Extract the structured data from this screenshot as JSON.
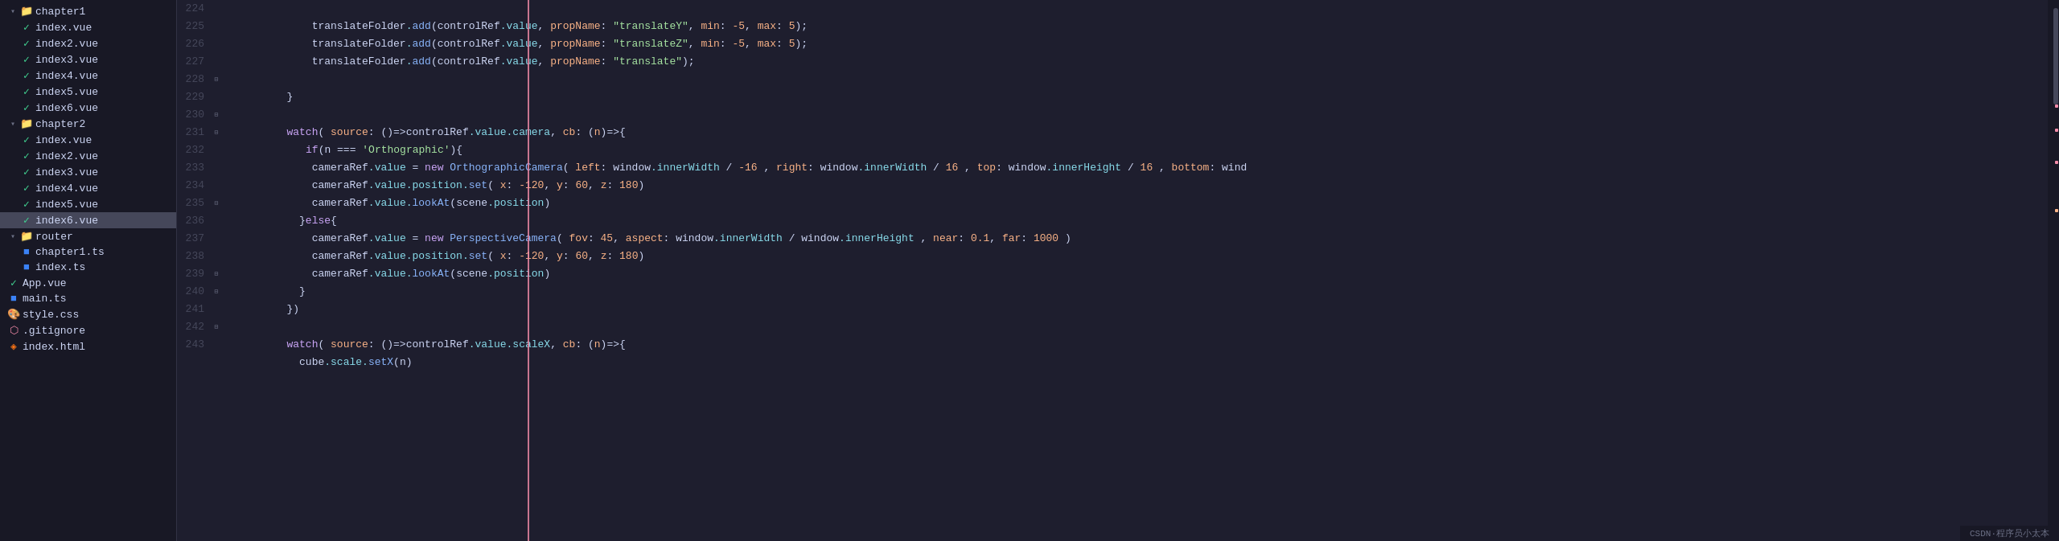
{
  "sidebar": {
    "items": [
      {
        "id": "chapter1-folder",
        "label": "chapter1",
        "type": "folder",
        "indent": 1,
        "expanded": true,
        "icon": "folder"
      },
      {
        "id": "chapter1-index",
        "label": "index.vue",
        "type": "file",
        "indent": 2,
        "icon": "vue"
      },
      {
        "id": "chapter1-index2",
        "label": "index2.vue",
        "type": "file",
        "indent": 2,
        "icon": "vue"
      },
      {
        "id": "chapter1-index3",
        "label": "index3.vue",
        "type": "file",
        "indent": 2,
        "icon": "vue"
      },
      {
        "id": "chapter1-index4",
        "label": "index4.vue",
        "type": "file",
        "indent": 2,
        "icon": "vue"
      },
      {
        "id": "chapter1-index5",
        "label": "index5.vue",
        "type": "file",
        "indent": 2,
        "icon": "vue"
      },
      {
        "id": "chapter1-index6",
        "label": "index6.vue",
        "type": "file",
        "indent": 2,
        "icon": "vue"
      },
      {
        "id": "chapter2-folder",
        "label": "chapter2",
        "type": "folder",
        "indent": 1,
        "expanded": true,
        "icon": "folder"
      },
      {
        "id": "chapter2-index",
        "label": "index.vue",
        "type": "file",
        "indent": 2,
        "icon": "vue"
      },
      {
        "id": "chapter2-index2",
        "label": "index2.vue",
        "type": "file",
        "indent": 2,
        "icon": "vue"
      },
      {
        "id": "chapter2-index3",
        "label": "index3.vue",
        "type": "file",
        "indent": 2,
        "icon": "vue"
      },
      {
        "id": "chapter2-index4",
        "label": "index4.vue",
        "type": "file",
        "indent": 2,
        "icon": "vue"
      },
      {
        "id": "chapter2-index5",
        "label": "index5.vue",
        "type": "file",
        "indent": 2,
        "icon": "vue"
      },
      {
        "id": "chapter2-index6",
        "label": "index6.vue",
        "type": "file",
        "indent": 2,
        "icon": "vue",
        "selected": true
      },
      {
        "id": "router-folder",
        "label": "router",
        "type": "folder",
        "indent": 1,
        "expanded": true,
        "icon": "folder"
      },
      {
        "id": "router-chapter1",
        "label": "chapter1.ts",
        "type": "file",
        "indent": 2,
        "icon": "ts"
      },
      {
        "id": "router-index",
        "label": "index.ts",
        "type": "file",
        "indent": 2,
        "icon": "ts"
      },
      {
        "id": "app-vue",
        "label": "App.vue",
        "type": "file",
        "indent": 1,
        "icon": "vue"
      },
      {
        "id": "main-ts",
        "label": "main.ts",
        "type": "file",
        "indent": 1,
        "icon": "ts"
      },
      {
        "id": "style-css",
        "label": "style.css",
        "type": "file",
        "indent": 1,
        "icon": "css"
      },
      {
        "id": "gitignore",
        "label": ".gitignore",
        "type": "file",
        "indent": 1,
        "icon": "git"
      },
      {
        "id": "index-html",
        "label": "index.html",
        "type": "file",
        "indent": 1,
        "icon": "html"
      }
    ]
  },
  "editor": {
    "lines": [
      {
        "num": 224,
        "content": "    translateFolder.add(controlRef.value, propName: \"translateY\", min: -5, max: 5);",
        "gutter": null
      },
      {
        "num": 225,
        "content": "    translateFolder.add(controlRef.value, propName: \"translateZ\", min: -5, max: 5);",
        "gutter": null
      },
      {
        "num": 226,
        "content": "    translateFolder.add(controlRef.value, propName: \"translate\");",
        "gutter": null
      },
      {
        "num": 227,
        "content": "",
        "gutter": null
      },
      {
        "num": 228,
        "content": "}",
        "gutter": "fold-end"
      },
      {
        "num": 229,
        "content": "",
        "gutter": null
      },
      {
        "num": 230,
        "content": "watch( source: ()=>controlRef.value.camera, cb: (n)=>{",
        "gutter": "fold"
      },
      {
        "num": 231,
        "content": "  if(n === 'Orthographic'){",
        "gutter": "fold"
      },
      {
        "num": 232,
        "content": "    cameraRef.value = new OrthographicCamera( left: window.innerWidth / -16 , right: window.innerWidth / 16 , top: window.innerHeight / 16 , bottom: wind",
        "gutter": null
      },
      {
        "num": 233,
        "content": "    cameraRef.value.position.set( x: -120, y: 60, z: 180)",
        "gutter": null
      },
      {
        "num": 234,
        "content": "    cameraRef.value.lookAt(scene.position)",
        "gutter": null
      },
      {
        "num": 235,
        "content": "  }else{",
        "gutter": "fold"
      },
      {
        "num": 236,
        "content": "    cameraRef.value = new PerspectiveCamera( fov: 45, aspect: window.innerWidth / window.innerHeight , near: 0.1, far: 1000 )",
        "gutter": null
      },
      {
        "num": 237,
        "content": "    cameraRef.value.position.set( x: -120, y: 60, z: 180)",
        "gutter": null
      },
      {
        "num": 238,
        "content": "    cameraRef.value.lookAt(scene.position)",
        "gutter": null
      },
      {
        "num": 239,
        "content": "  }",
        "gutter": null
      },
      {
        "num": 240,
        "content": "})",
        "gutter": "fold-end"
      },
      {
        "num": 241,
        "content": "",
        "gutter": null
      },
      {
        "num": 242,
        "content": "watch( source: ()=>controlRef.value.scaleX, cb: (n)=>{",
        "gutter": "fold"
      },
      {
        "num": 243,
        "content": "  cube.scale.setX(n)",
        "gutter": null
      }
    ]
  },
  "watermark": "CSDN·程序员小太本",
  "colors": {
    "keyword": "#cba6f7",
    "function": "#89b4fa",
    "string": "#a6e3a1",
    "number": "#fab387",
    "property": "#89dceb",
    "variable": "#cdd6f4",
    "red": "#f38ba8",
    "orange": "#fab387",
    "folder": "#f9c74f",
    "vue": "#42d392",
    "ts": "#3b82f6"
  }
}
